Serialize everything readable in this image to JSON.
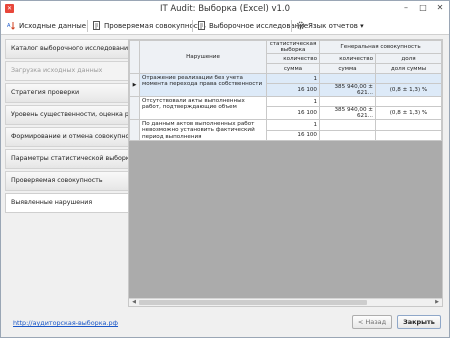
{
  "window": {
    "title": "IT Audit: Выборка (Excel) v1.0",
    "app_icon": "audit-app-icon",
    "controls": [
      "minimize",
      "maximize",
      "close"
    ]
  },
  "toolbar": {
    "source_data": "Исходные данные",
    "checked_set": "Проверяемая совокупность",
    "sample_study": "Выборочное исследование",
    "report_lang": "Язык отчетов ▾"
  },
  "sidebar": {
    "items": [
      {
        "label": "Каталог выборочного исследования",
        "state": "normal"
      },
      {
        "label": "Загрузка исходных данных",
        "state": "disabled"
      },
      {
        "label": "Стратегия проверки",
        "state": "normal"
      },
      {
        "label": "Уровень существенности, оценка риска",
        "state": "normal"
      },
      {
        "label": "Формирование и отмена совокупностей",
        "state": "normal"
      },
      {
        "label": "Параметры статистической выборки",
        "state": "normal"
      },
      {
        "label": "Проверяемая совокупность",
        "state": "normal"
      },
      {
        "label": "Выявленные нарушения",
        "state": "active"
      }
    ]
  },
  "grid": {
    "header_violation": "Нарушение",
    "header_stat_sample": "статистическая выборка",
    "header_population": "Генеральная совокупность",
    "sub_count": "количество",
    "sub_sum": "сумма",
    "sub_count2": "количество",
    "sub_share": "доля",
    "sub_sum2": "сумма",
    "sub_sum3": "сумма",
    "sub_share_sum": "доля суммы",
    "rows": [
      {
        "violation": "Отражение реализации без учета момента перехода права собственности",
        "count": "1",
        "sum": "16 100",
        "pop_sum": "385 940,00 ± 621...",
        "pop_share": "(0,8 ± 1,3) %"
      },
      {
        "violation": "Отсутствовали акты выполненных работ, подтверждающие объем",
        "count": "1",
        "sum": "16 100",
        "pop_sum": "385 940,00 ± 621...",
        "pop_share": "(0,8 ± 1,3) %"
      },
      {
        "violation": "По данным актов выполненных работ невозможно установить фактический период выполнения",
        "count": "1",
        "sum": "16 100",
        "pop_sum": "",
        "pop_share": ""
      }
    ]
  },
  "footer": {
    "link": "http://аудиторская-выборка.рф",
    "back": "< Назад",
    "close": "Закрыть"
  },
  "colors": {
    "accent": "#1a57c8",
    "selected_row": "#ddeaf8",
    "grid_empty": "#ababab"
  }
}
